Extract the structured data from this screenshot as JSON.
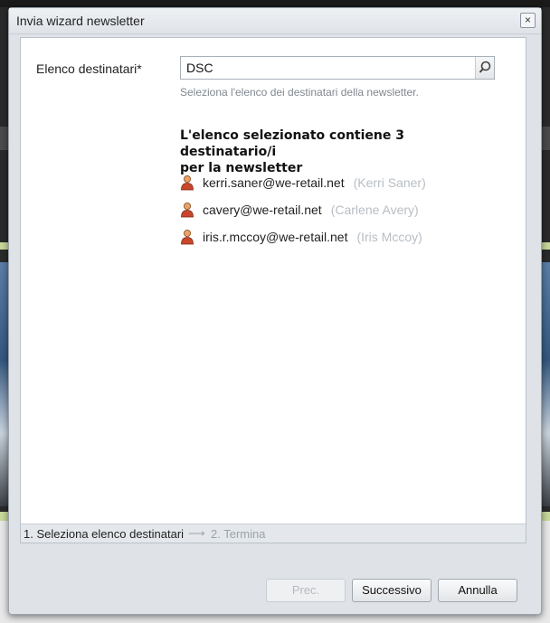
{
  "dialog": {
    "title": "Invia wizard newsletter",
    "close_label": "×"
  },
  "form": {
    "recipients_label": "Elenco destinatari",
    "required_mark": "*",
    "recipients_value": "DSC",
    "recipients_help": "Seleziona l'elenco dei destinatari della newsletter."
  },
  "summary": {
    "line1": "L'elenco selezionato contiene 3 destinatario/i",
    "line2": "per la newsletter"
  },
  "recipients": [
    {
      "email": "kerri.saner@we-retail.net",
      "name": "(Kerri Saner)"
    },
    {
      "email": "cavery@we-retail.net",
      "name": "(Carlene Avery)"
    },
    {
      "email": "iris.r.mccoy@we-retail.net",
      "name": "(Iris Mccoy)"
    }
  ],
  "steps": {
    "step1": "1. Seleziona elenco destinatari",
    "arrow": "⟶",
    "step2": "2. Termina"
  },
  "buttons": {
    "prev": "Prec.",
    "next": "Successivo",
    "cancel": "Annulla"
  }
}
